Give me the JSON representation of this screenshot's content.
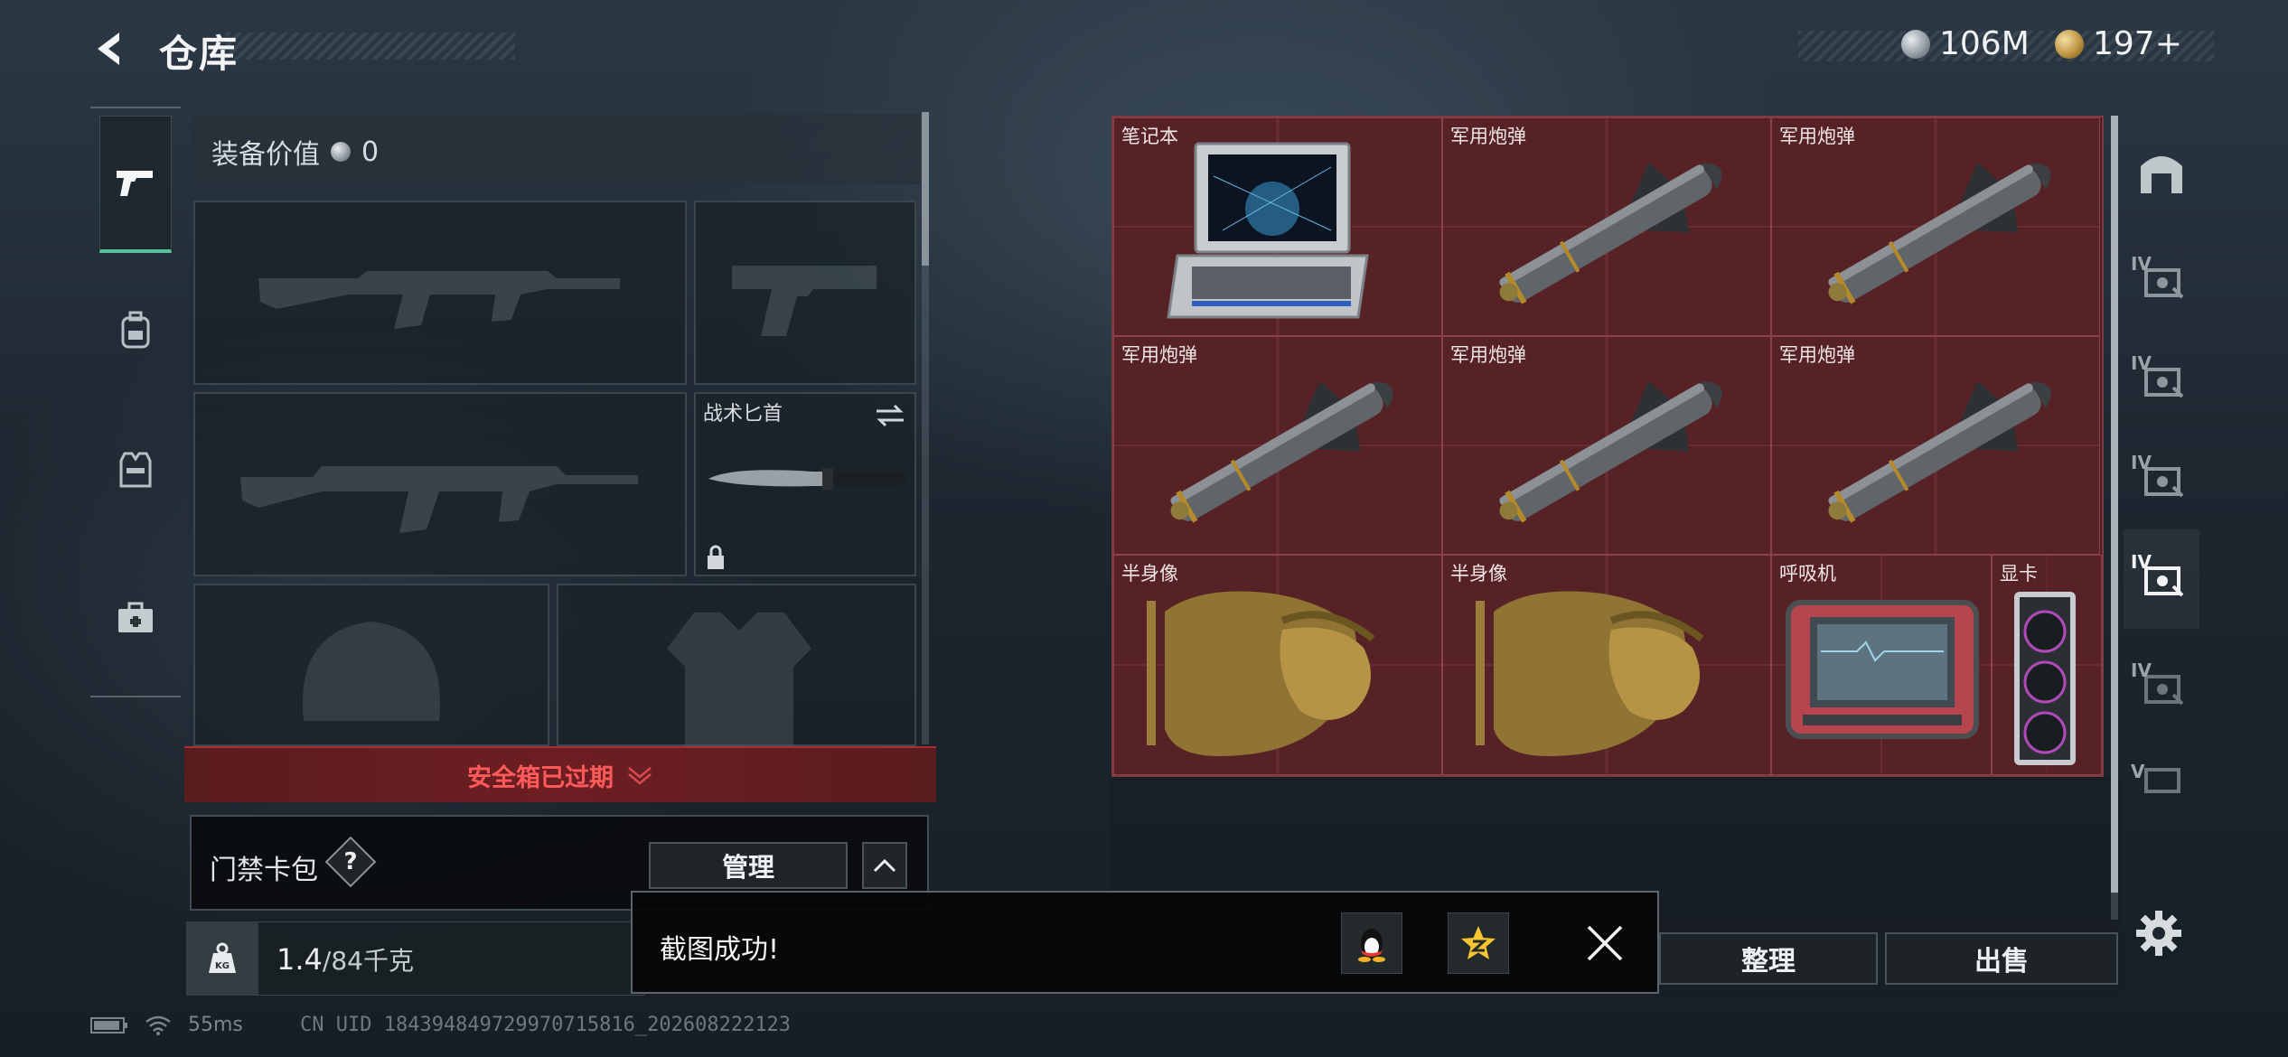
{
  "header": {
    "title": "仓库",
    "currencies": [
      {
        "icon": "silver-coin-icon",
        "amount": "106M"
      },
      {
        "icon": "gold-triangle-coin-icon",
        "amount": "197+"
      }
    ]
  },
  "left_nav": {
    "items": [
      {
        "icon": "pistol-icon",
        "active": true
      },
      {
        "icon": "backpack-icon"
      },
      {
        "icon": "vest-icon"
      },
      {
        "icon": "medkit-case-icon"
      }
    ]
  },
  "equipment": {
    "value_label": "装备价值",
    "value": "0",
    "knife_slot_label": "战术匕首",
    "safe_box_status": "安全箱已过期"
  },
  "keycard": {
    "label": "门禁卡包",
    "help": "?",
    "manage_label": "管理"
  },
  "weight": {
    "current": "1.4",
    "capacity": "/84千克",
    "icon_label": "KG"
  },
  "stash": {
    "items": [
      {
        "label": "笔记本",
        "art": "laptop"
      },
      {
        "label": "军用炮弹",
        "art": "missile"
      },
      {
        "label": "军用炮弹",
        "art": "missile"
      },
      {
        "label": "军用炮弹",
        "art": "missile"
      },
      {
        "label": "军用炮弹",
        "art": "missile"
      },
      {
        "label": "军用炮弹",
        "art": "missile"
      },
      {
        "label": "半身像",
        "art": "bust"
      },
      {
        "label": "半身像",
        "art": "bust"
      },
      {
        "label": "呼吸机",
        "art": "ventilator"
      },
      {
        "label": "显卡",
        "art": "gpu"
      }
    ]
  },
  "right_bar": {
    "tags": [
      "IV",
      "IV",
      "IV",
      "IV",
      "IV",
      "V"
    ]
  },
  "actions": {
    "sort_label": "整理",
    "sell_label": "出售"
  },
  "toast": {
    "message": "截图成功!"
  },
  "status_bar": {
    "ping": "55ms",
    "uid": "CN UID 18439484972997071581​6_202608222123"
  }
}
